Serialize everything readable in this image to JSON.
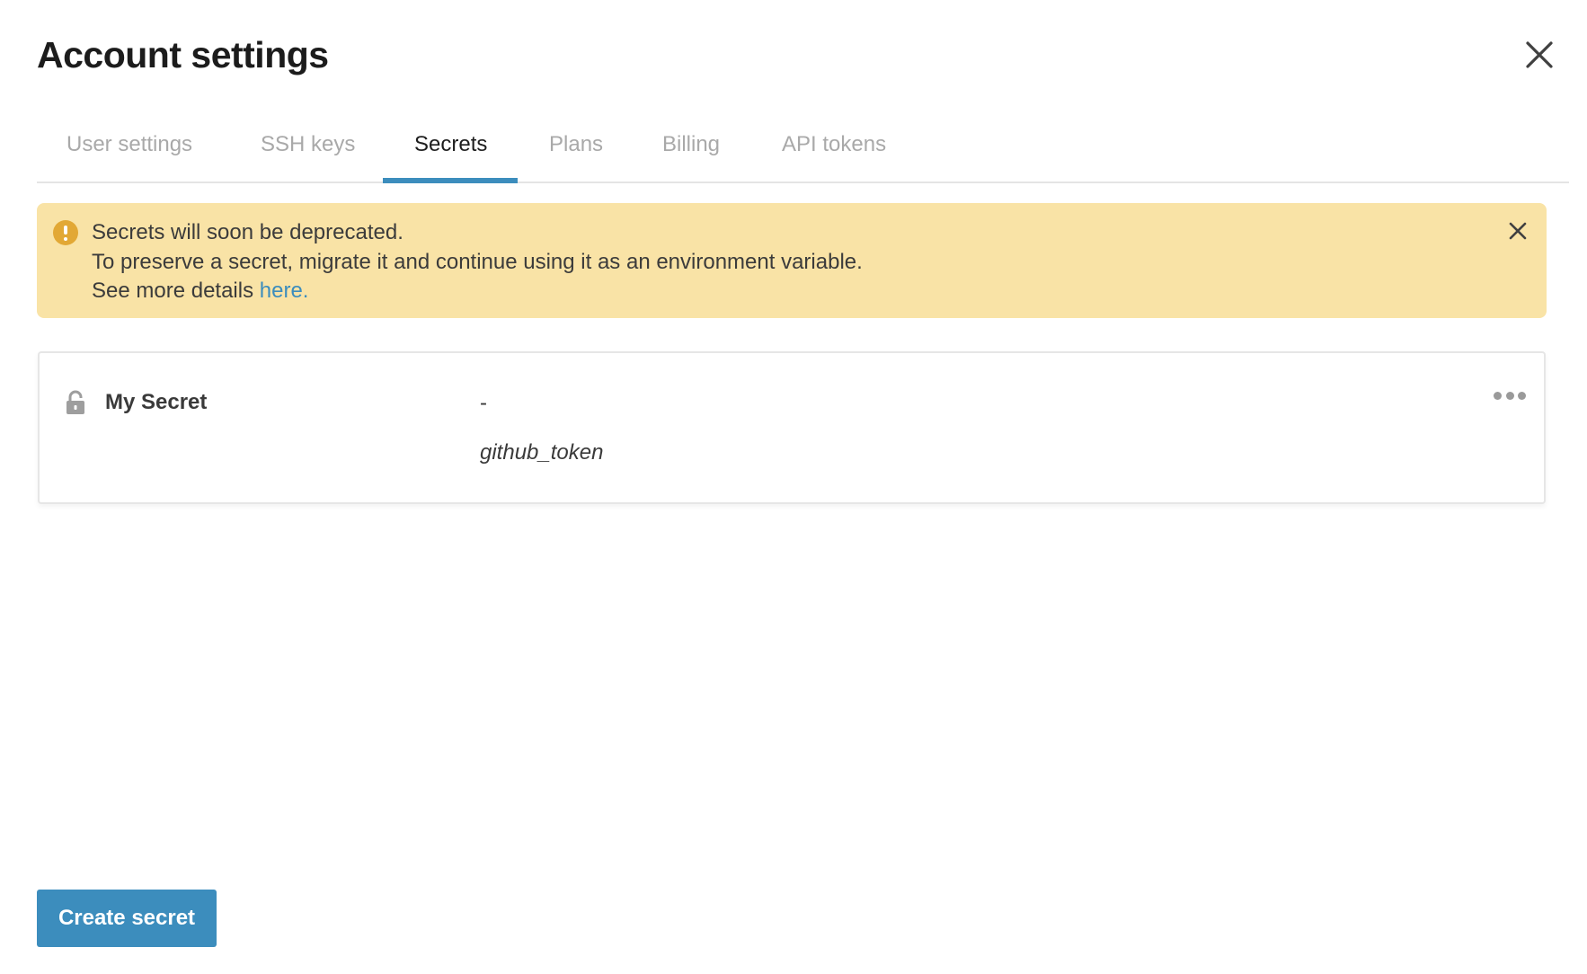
{
  "modal": {
    "title": "Account settings",
    "close_icon": "close-icon"
  },
  "tabs": [
    {
      "label": "User settings",
      "active": false
    },
    {
      "label": "SSH keys",
      "active": false
    },
    {
      "label": "Secrets",
      "active": true
    },
    {
      "label": "Plans",
      "active": false
    },
    {
      "label": "Billing",
      "active": false
    },
    {
      "label": "API tokens",
      "active": false
    }
  ],
  "alert": {
    "icon": "warning-icon",
    "line1": "Secrets will soon be deprecated.",
    "line2": "To preserve a secret, migrate it and continue using it as an environment variable.",
    "line3_prefix": "See more details ",
    "link_text": "here.",
    "close_icon": "close-icon"
  },
  "secrets": [
    {
      "icon": "lock-icon",
      "name": "My Secret",
      "description": "-",
      "key": "github_token",
      "menu_icon": "more-horizontal-icon"
    }
  ],
  "footer": {
    "create_label": "Create secret"
  },
  "colors": {
    "accent": "#3c8dbd",
    "alert_background": "#f9e3a6",
    "alert_icon": "#e2a835",
    "inactive_tab": "#a9a9a9"
  }
}
